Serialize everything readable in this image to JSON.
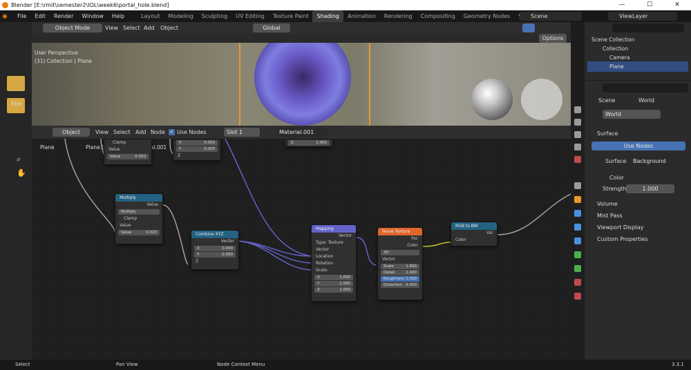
{
  "window": {
    "title": "Blender [E:\\rmit\\semester2\\IOL\\week6\\portal_hole.blend]",
    "min": "—",
    "max": "☐",
    "close": "✕"
  },
  "menu": [
    "File",
    "Edit",
    "Render",
    "Window",
    "Help"
  ],
  "workspaces": [
    "Layout",
    "Modeling",
    "Sculpting",
    "UV Editing",
    "Texture Paint",
    "Shading",
    "Animation",
    "Rendering",
    "Compositing",
    "Geometry Nodes",
    "Scripting"
  ],
  "scene": "Scene",
  "viewlayer": "ViewLayer",
  "viewport": {
    "mode": "Object Mode",
    "menus": [
      "View",
      "Select",
      "Add",
      "Object"
    ],
    "orientation": "Global",
    "options": "Options",
    "perspective": "User Perspective",
    "collection_info": "(31) Collection | Plane"
  },
  "node_editor": {
    "type": "Object",
    "menus": [
      "View",
      "Select",
      "Add",
      "Node"
    ],
    "use_nodes": "Use Nodes",
    "slot": "Slot 1",
    "material": "Material.001",
    "breadcrumb": [
      "Plane",
      "Plane.001",
      "Material.001"
    ],
    "nodes": {
      "top_left": {
        "clamp": "Clamp",
        "value_label": "Value",
        "value_field": "Value",
        "value": "0.050"
      },
      "top_mid": {
        "x_label": "X",
        "x": "0.000",
        "y_label": "Y",
        "y": "0.000",
        "z": "Z"
      },
      "top_right": {
        "z_label": "Z",
        "z": "1.000"
      },
      "multiply": {
        "title": "Multiply",
        "out": "Value",
        "op": "Multiply",
        "clamp": "Clamp",
        "in": "Value",
        "value_label": "Value",
        "value": "0.020"
      },
      "combine": {
        "title": "Combine XYZ",
        "out": "Vector",
        "x_label": "X",
        "x": "0.000",
        "y_label": "Y",
        "y": "0.000",
        "z": "Z"
      },
      "mapping": {
        "title": "Mapping",
        "out": "Vector",
        "type_label": "Type:",
        "type": "Texture",
        "in_vector": "Vector",
        "location": "Location",
        "rotation": "Rotation",
        "scale": "Scale:",
        "x_label": "X",
        "x": "1.000",
        "y_label": "Y",
        "y": "1.000",
        "z_label": "Z",
        "z": "1.000"
      },
      "noise": {
        "title": "Noise Texture",
        "fac": "Fac",
        "color": "Color",
        "dim": "3D",
        "vector": "Vector",
        "scale_label": "Scale",
        "scale": "1.600",
        "detail_label": "Detail",
        "detail": "2.000",
        "rough_label": "Roughness",
        "rough": "1.000",
        "dist_label": "Distortion",
        "dist": "0.000"
      },
      "rgbtobw": {
        "title": "RGB to BW",
        "val": "Val",
        "color": "Color"
      }
    }
  },
  "outliner": {
    "root": "Scene Collection",
    "items": [
      "Collection",
      "Camera",
      "Plane"
    ]
  },
  "properties": {
    "path": [
      "Scene",
      "World"
    ],
    "world_name": "World",
    "surface": "Surface",
    "use_nodes_btn": "Use Nodes",
    "surface_label": "Surface",
    "surface_value": "Background",
    "color_label": "Color",
    "strength_label": "Strength",
    "strength": "1.000",
    "panels": [
      "Volume",
      "Mist Pass",
      "Viewport Display",
      "Custom Properties"
    ]
  },
  "left": {
    "label": "Ebe"
  },
  "status": {
    "select": "Select",
    "pan": "Pan View",
    "context": "Node Context Menu",
    "version": "3.3.1"
  }
}
